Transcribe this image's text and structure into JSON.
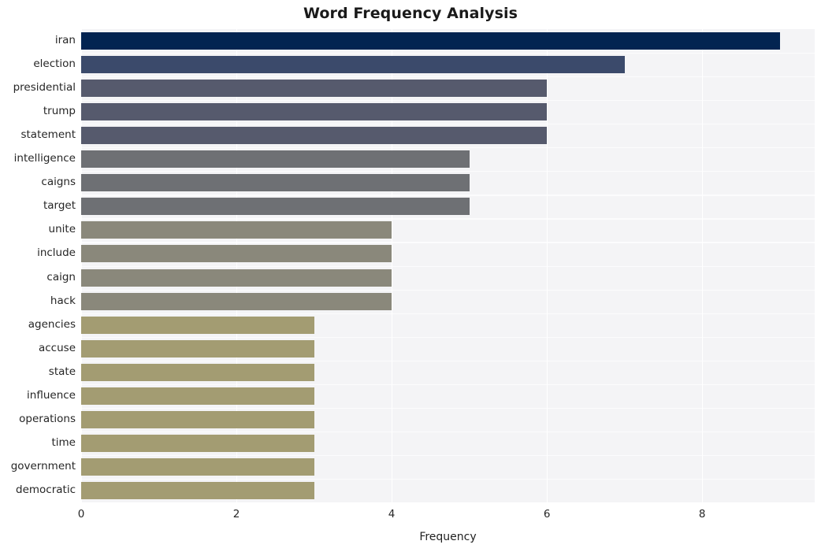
{
  "chart_data": {
    "type": "bar",
    "orientation": "horizontal",
    "title": "Word Frequency Analysis",
    "xlabel": "Frequency",
    "ylabel": "",
    "categories": [
      "iran",
      "election",
      "presidential",
      "trump",
      "statement",
      "intelligence",
      "caigns",
      "target",
      "unite",
      "include",
      "caign",
      "hack",
      "agencies",
      "accuse",
      "state",
      "influence",
      "operations",
      "time",
      "government",
      "democratic"
    ],
    "values": [
      9,
      7,
      6,
      6,
      6,
      5,
      5,
      5,
      4,
      4,
      4,
      4,
      3,
      3,
      3,
      3,
      3,
      3,
      3,
      3
    ],
    "bar_colors": [
      "#032451",
      "#3b4a6b",
      "#565a6d",
      "#565a6d",
      "#565a6d",
      "#6e7074",
      "#6e7074",
      "#6e7074",
      "#8a887b",
      "#8a887b",
      "#8a887b",
      "#8a887b",
      "#a39c72",
      "#a39c72",
      "#a39c72",
      "#a39c72",
      "#a39c72",
      "#a39c72",
      "#a39c72",
      "#a39c72"
    ],
    "xticks": [
      0,
      2,
      4,
      6,
      8
    ],
    "xtick_labels": [
      "0",
      "2",
      "4",
      "6",
      "8"
    ],
    "xlim": [
      0,
      9.45
    ],
    "grid": true,
    "grid_axis": "x",
    "legend": "none",
    "plot_background": "#f4f4f6",
    "figure_background": "#ffffff",
    "gridline_color": "#ffffff",
    "title_color": "#1a1a1a",
    "tick_label_color": "#262626"
  }
}
